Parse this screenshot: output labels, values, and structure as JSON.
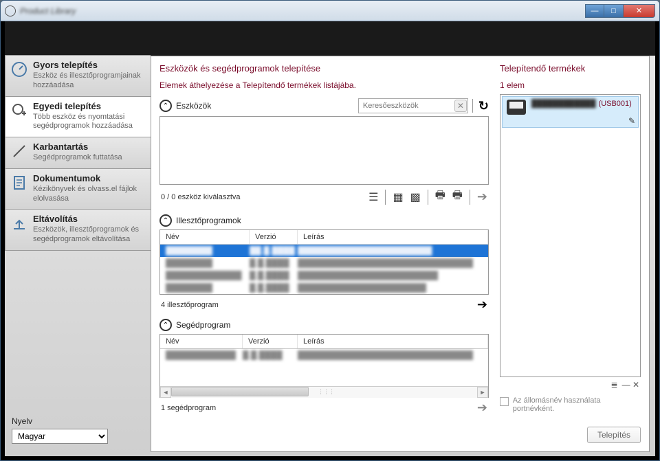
{
  "window": {
    "title": "Product Library"
  },
  "winbtn": {
    "min": "—",
    "max": "□",
    "close": "✕"
  },
  "nav": {
    "quick": {
      "title": "Gyors telepítés",
      "desc": "Eszköz és illesztőprogramjainak hozzáadása"
    },
    "custom": {
      "title": "Egyedi telepítés",
      "desc": "Több eszköz és nyomtatási segédprogramok hozzáadása"
    },
    "maint": {
      "title": "Karbantartás",
      "desc": "Segédprogramok futtatása"
    },
    "docs": {
      "title": "Dokumentumok",
      "desc": "Kézikönyvek és olvass.el fájlok elolvasása"
    },
    "uninst": {
      "title": "Eltávolítás",
      "desc": "Eszközök, illesztőprogramok és segédprogramok eltávolítása"
    }
  },
  "lang": {
    "label": "Nyelv",
    "value": "Magyar"
  },
  "page": {
    "title": "Eszközök és segédprogramok telepítése",
    "instruction": "Elemek áthelyezése a Telepítendő termékek listájába."
  },
  "devices": {
    "heading": "Eszközök",
    "search_placeholder": "Keresőeszközök",
    "selection": "0 / 0 eszköz kiválasztva"
  },
  "drivers": {
    "heading": "Illesztőprogramok",
    "count": "4 illesztőprogram",
    "cols": {
      "name": "Név",
      "ver": "Verzió",
      "desc": "Leírás"
    },
    "rows": [
      {
        "name": "████████",
        "ver": "██.█.████",
        "desc": "███████████████████████"
      },
      {
        "name": "████████",
        "ver": "█.█.████",
        "desc": "██████████████████████████████"
      },
      {
        "name": "█████████████",
        "ver": "█.█.████",
        "desc": "████████████████████████"
      },
      {
        "name": "████████",
        "ver": "█.█.████",
        "desc": "██████████████████████"
      }
    ]
  },
  "utils": {
    "heading": "Segédprogram",
    "count": "1 segédprogram",
    "cols": {
      "name": "Név",
      "ver": "Verzió",
      "desc": "Leírás"
    },
    "rows": [
      {
        "name": "████████████",
        "ver": "█.█.████",
        "desc": "██████████████████████████████"
      }
    ]
  },
  "right": {
    "title": "Telepítendő termékek",
    "count": "1 elem",
    "item_port": "(USB001)",
    "hostname_label": "Az állomásnév használata portnévként.",
    "install": "Telepítés"
  }
}
